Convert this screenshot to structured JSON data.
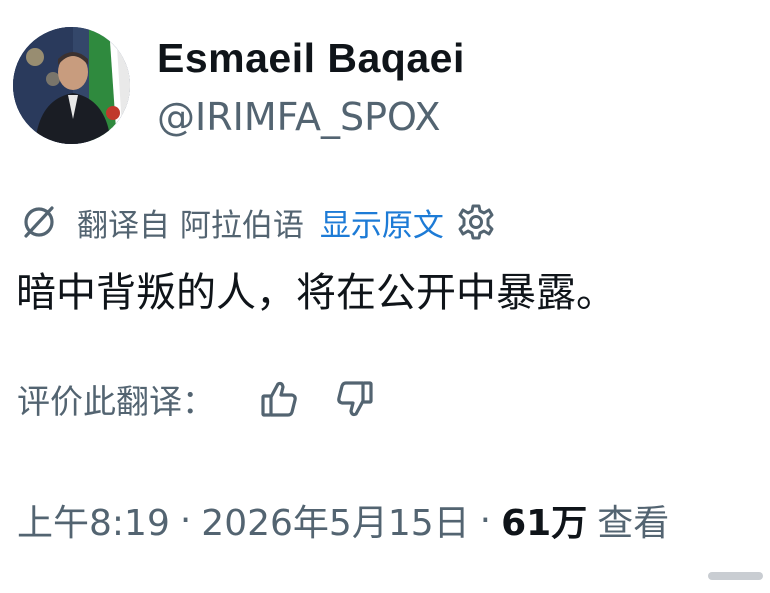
{
  "profile": {
    "display_name": "Esmaeil Baqaei",
    "handle": "@IRIMFA_SPOX",
    "avatar_icon": "profile-photo"
  },
  "translation": {
    "icon": "translate-icon",
    "from_label": "翻译自 阿拉伯语",
    "show_original_label": "显示原文",
    "settings_icon": "gear-icon"
  },
  "tweet": {
    "text": "暗中背叛的人，将在公开中暴露。"
  },
  "rating": {
    "label": "评价此翻译：",
    "up_icon": "thumbs-up-icon",
    "down_icon": "thumbs-down-icon"
  },
  "meta": {
    "time": "上午8:19",
    "separator": "·",
    "date": "2026年5月15日",
    "views_count": "61万",
    "views_label": "查看"
  },
  "colors": {
    "text_primary": "#0f1419",
    "text_secondary": "#536471",
    "link": "#1d7bd6"
  }
}
